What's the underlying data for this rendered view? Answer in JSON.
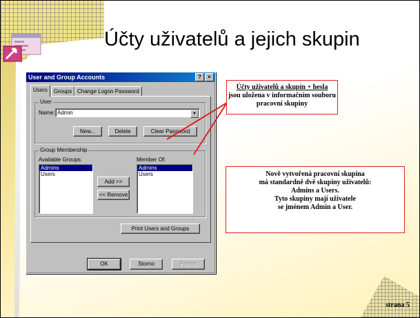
{
  "slide": {
    "title": "Účty uživatelů a jejich skupin",
    "page_label": "strana 5",
    "accent_color": "#e02020"
  },
  "dialog": {
    "title": "User and Group Accounts",
    "title_buttons": [
      "?",
      "×"
    ],
    "tabs": [
      {
        "label": "Users",
        "active": true
      },
      {
        "label": "Groups",
        "active": false
      },
      {
        "label": "Change Logon Password",
        "active": false
      }
    ],
    "user_group_label": "User",
    "name_label": "Name:",
    "name_value": "Admin",
    "buttons": {
      "new": "New...",
      "delete": "Delete",
      "clear_password": "Clear Password"
    },
    "membership_group_label": "Group Membership",
    "available_groups_label": "Available Groups:",
    "available_groups": [
      {
        "label": "Admins",
        "selected": true
      },
      {
        "label": "Users",
        "selected": false
      }
    ],
    "member_of_label": "Member Of:",
    "member_of": [
      {
        "label": "Admins",
        "selected": true
      },
      {
        "label": "Users",
        "selected": false
      }
    ],
    "add_button": "Add >>",
    "remove_button": "<< Remove",
    "print_button": "Print Users and Groups",
    "ok_button": "OK",
    "cancel_button": "Storno",
    "help_button": "Pomoc"
  },
  "notes": {
    "top_title": "Účty uživatelů a skupin + hesla",
    "top_body": "jsou uložena v informačním souboru pracovní skupiny",
    "bottom_lines": [
      "Nově vytvořená pracovní skupina",
      "má standardně dvě skupiny uživatelů:",
      "Admins a Users.",
      "Tyto skupiny mají uživatele",
      "se jménem Admin a User."
    ]
  }
}
